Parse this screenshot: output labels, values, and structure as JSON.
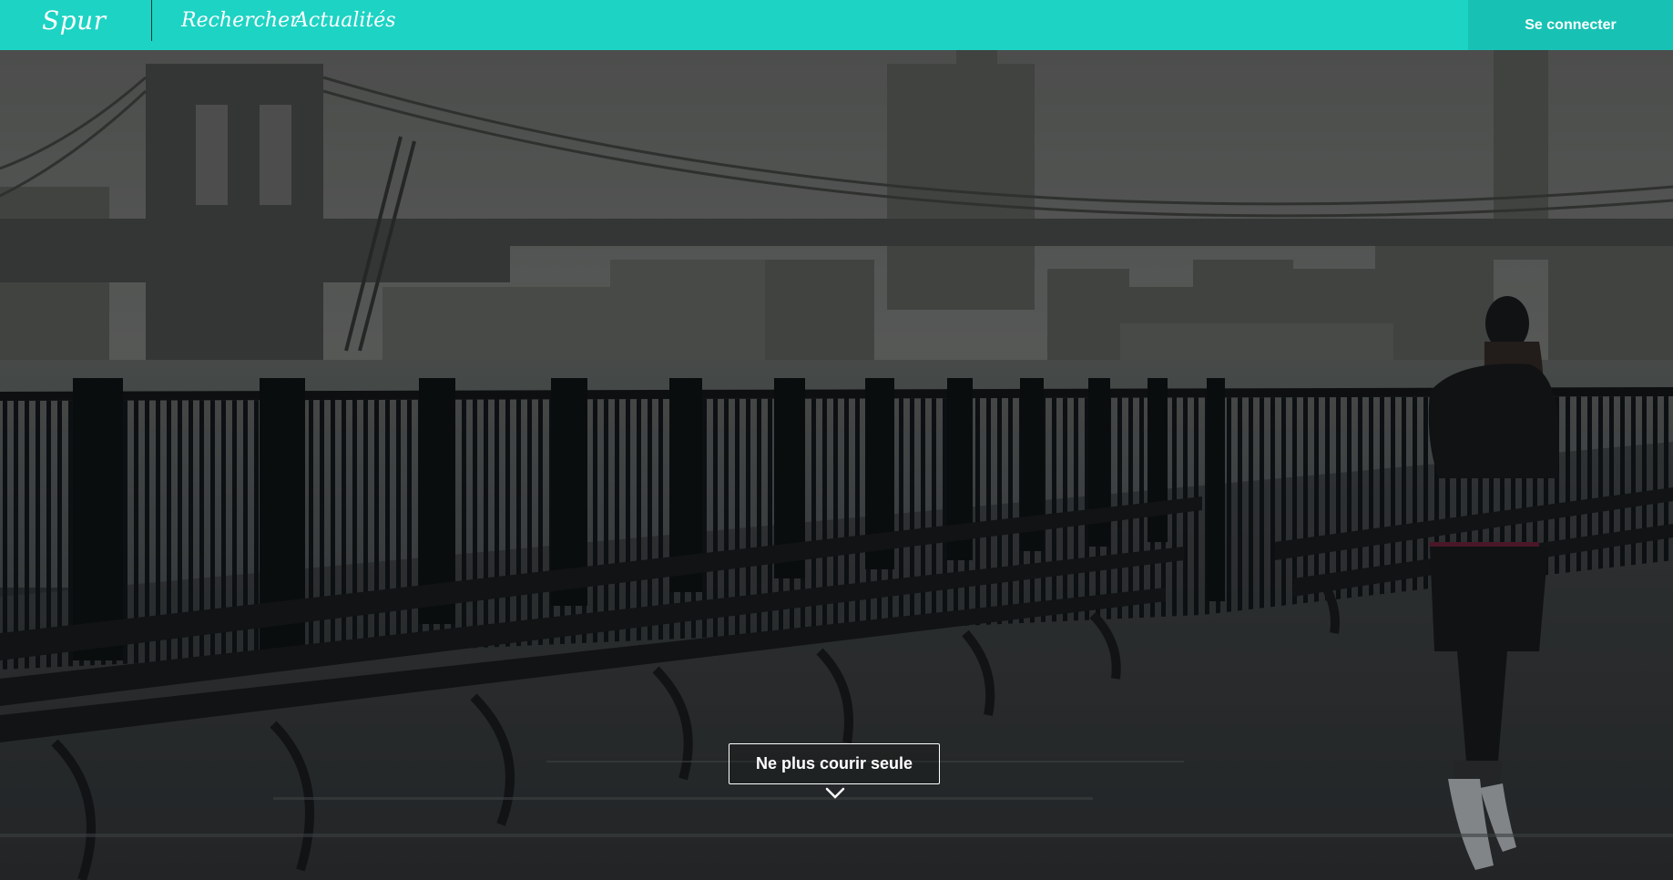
{
  "header": {
    "brand": "Spur",
    "nav": [
      {
        "label": "Rechercher"
      },
      {
        "label": "Actualités"
      }
    ],
    "login_label": "Se connecter",
    "accent_color": "#1dd3c4"
  },
  "hero": {
    "cta_label": "Ne plus courir seule",
    "scroll_icon": "chevron-down-icon"
  }
}
